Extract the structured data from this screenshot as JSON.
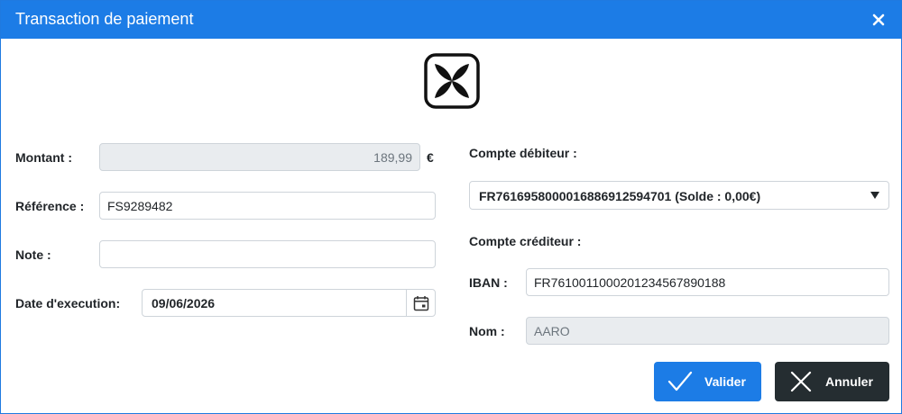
{
  "dialog": {
    "title": "Transaction de paiement",
    "accent_color": "#1c7ce6"
  },
  "form": {
    "montant": {
      "label": "Montant :",
      "value": "189,99",
      "currency": "€"
    },
    "reference": {
      "label": "Référence :",
      "value": "FS9289482"
    },
    "note": {
      "label": "Note :",
      "value": ""
    },
    "date": {
      "label": "Date d'execution:",
      "value": "09/06/2026"
    },
    "compte_debiteur": {
      "label": "Compte débiteur :",
      "selected": "FR7616958000016886912594701 (Solde : 0,00€)"
    },
    "compte_crediteur": {
      "label": "Compte créditeur :"
    },
    "iban": {
      "label": "IBAN :",
      "value": "FR7610011000201234567890188"
    },
    "nom": {
      "label": "Nom :",
      "value": "AARO"
    }
  },
  "buttons": {
    "valider": "Valider",
    "annuler": "Annuler",
    "dark_color": "#252d31"
  }
}
